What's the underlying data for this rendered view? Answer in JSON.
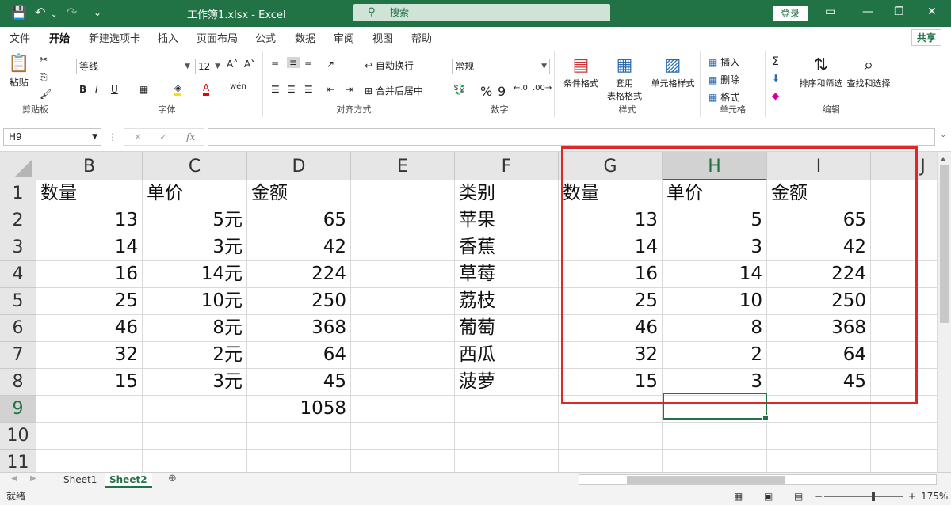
{
  "titlebar": {
    "doc_title": "工作簿1.xlsx  -  Excel",
    "search_placeholder": "搜索",
    "login": "登录",
    "icons": [
      "save-icon",
      "undo-icon",
      "redo-icon",
      "customize-icon",
      "ribbon-display-icon",
      "minimize-icon",
      "restore-icon",
      "close-icon"
    ]
  },
  "tabs": [
    "文件",
    "开始",
    "新建选项卡",
    "插入",
    "页面布局",
    "公式",
    "数据",
    "审阅",
    "视图",
    "帮助"
  ],
  "active_tab": "开始",
  "share": "共享",
  "ribbon": {
    "clipboard": {
      "label": "剪贴板",
      "paste": "粘贴"
    },
    "font": {
      "label": "字体",
      "font_name": "等线",
      "font_size": "12"
    },
    "alignment": {
      "label": "对齐方式",
      "wrap": "自动换行",
      "merge": "合并后居中"
    },
    "number": {
      "label": "数字",
      "format": "常规"
    },
    "styles": {
      "label": "样式",
      "cond": "条件格式",
      "table": "套用\n表格格式",
      "cell": "单元格样式"
    },
    "cells": {
      "label": "单元格",
      "insert": "插入",
      "delete": "删除",
      "format": "格式"
    },
    "editing": {
      "label": "编辑",
      "sort": "排序和筛选",
      "find": "查找和选择"
    }
  },
  "formula_bar": {
    "name_box": "H9",
    "fx": "fx",
    "value": ""
  },
  "columns": [
    "B",
    "C",
    "D",
    "E",
    "F",
    "G",
    "H",
    "I",
    "J"
  ],
  "selected_column": "H",
  "rows": [
    "1",
    "2",
    "3",
    "4",
    "5",
    "6",
    "7",
    "8",
    "9",
    "10",
    "11"
  ],
  "selected_row": "9",
  "cells": {
    "B": [
      "数量",
      "13",
      "14",
      "16",
      "25",
      "46",
      "32",
      "15",
      "",
      "",
      ""
    ],
    "C": [
      "单价",
      "5元",
      "3元",
      "14元",
      "10元",
      "8元",
      "2元",
      "3元",
      "",
      "",
      ""
    ],
    "D": [
      "金额",
      "65",
      "42",
      "224",
      "250",
      "368",
      "64",
      "45",
      "1058",
      "",
      ""
    ],
    "E": [
      "",
      "",
      "",
      "",
      "",
      "",
      "",
      "",
      "",
      "",
      ""
    ],
    "F": [
      "类别",
      "苹果",
      "香蕉",
      "草莓",
      "荔枝",
      "葡萄",
      "西瓜",
      "菠萝",
      "",
      "",
      ""
    ],
    "G": [
      "数量",
      "13",
      "14",
      "16",
      "25",
      "46",
      "32",
      "15",
      "",
      "",
      ""
    ],
    "H": [
      "单价",
      "5",
      "3",
      "14",
      "10",
      "8",
      "2",
      "3",
      "",
      "",
      ""
    ],
    "I": [
      "金额",
      "65",
      "42",
      "224",
      "250",
      "368",
      "64",
      "45",
      "",
      "",
      ""
    ],
    "J": [
      "",
      "",
      "",
      "",
      "",
      "",
      "",
      "",
      "",
      "",
      ""
    ]
  },
  "sheets": [
    "Sheet1",
    "Sheet2"
  ],
  "active_sheet": "Sheet2",
  "status": {
    "mode": "就绪",
    "zoom": "175%"
  }
}
